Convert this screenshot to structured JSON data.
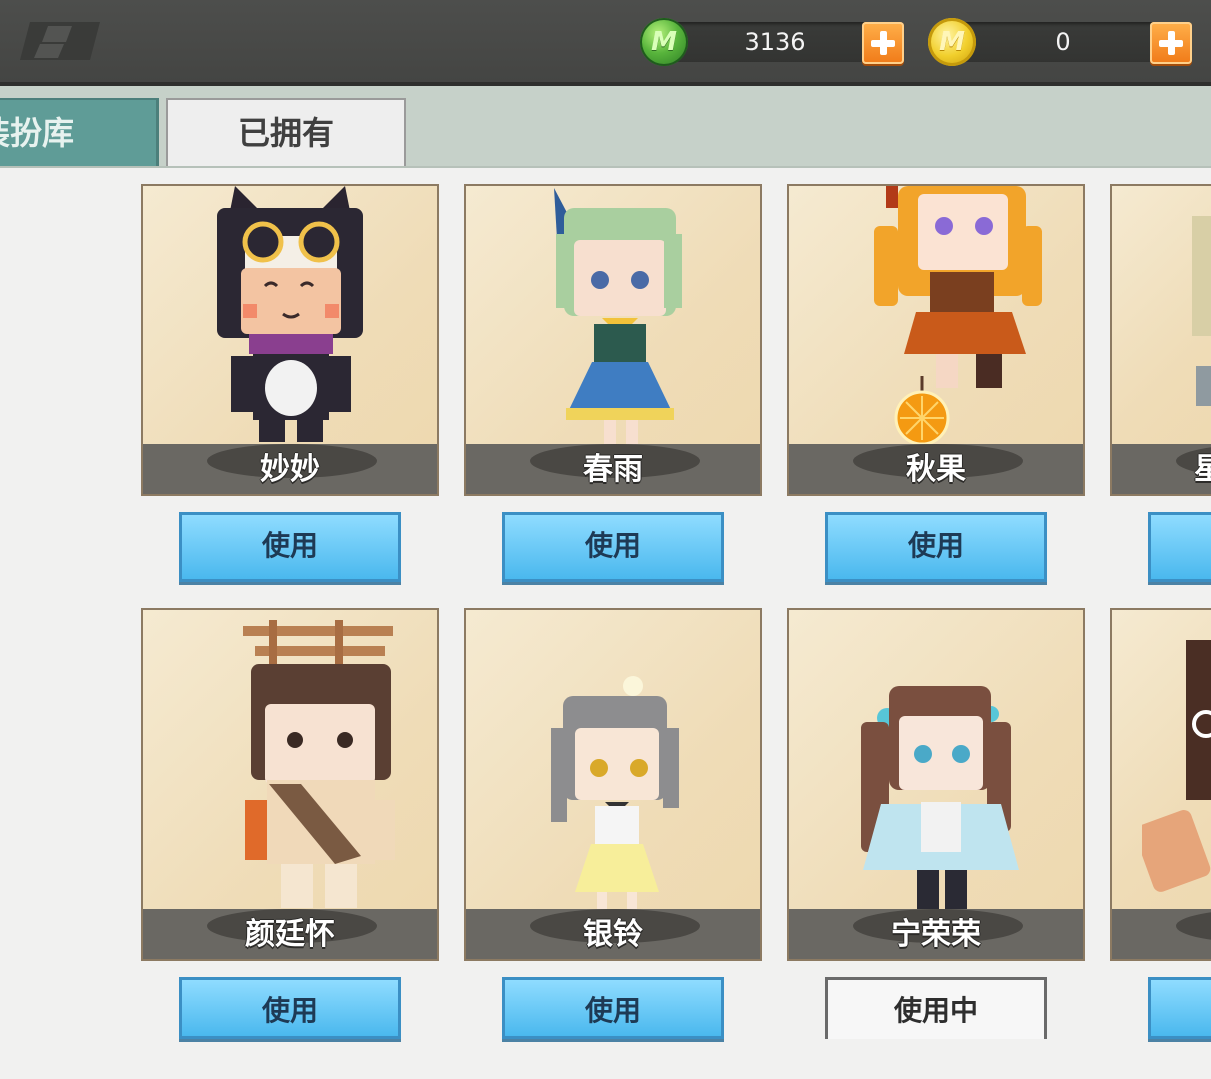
{
  "currency": {
    "mini_beans": {
      "icon": "mini-bean-gem-icon",
      "letter": "M",
      "amount": "3136"
    },
    "mini_coins": {
      "icon": "mini-coin-icon",
      "letter": "M",
      "amount": "0"
    }
  },
  "tabs": [
    {
      "label": "装扮库",
      "selected": false
    },
    {
      "label": "已拥有",
      "selected": true
    }
  ],
  "skins": [
    {
      "name": "妙妙",
      "button": "使用",
      "in_use": false
    },
    {
      "name": "春雨",
      "button": "使用",
      "in_use": false
    },
    {
      "name": "秋果",
      "button": "使用",
      "in_use": false
    },
    {
      "name": "星",
      "button": "",
      "in_use": false
    },
    {
      "name": "颜廷怀",
      "button": "使用",
      "in_use": false
    },
    {
      "name": "银铃",
      "button": "使用",
      "in_use": false
    },
    {
      "name": "宁荣荣",
      "button": "使用中",
      "in_use": true
    },
    {
      "name": "",
      "button": "",
      "in_use": false
    }
  ],
  "colors": {
    "use_button": "#4ab8ee",
    "active_tab": "#5f9c97",
    "plus_button": "#f07a18"
  }
}
